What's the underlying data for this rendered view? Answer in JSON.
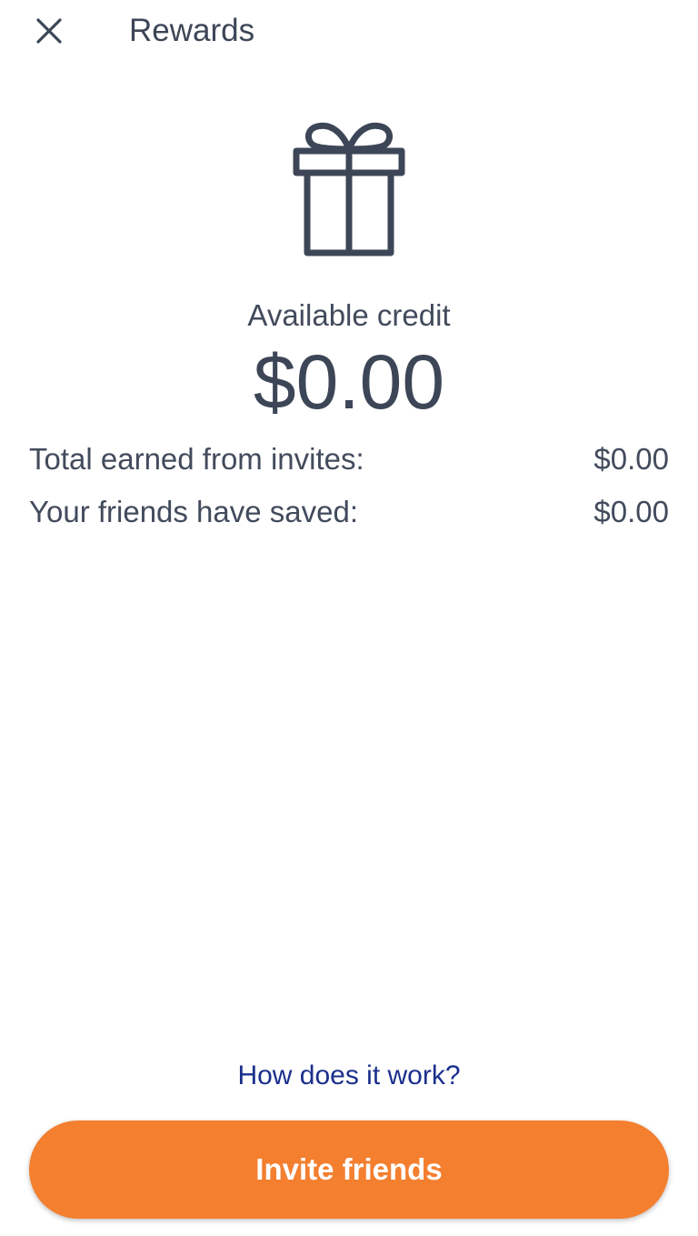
{
  "header": {
    "title": "Rewards",
    "close_icon": "close-icon"
  },
  "hero": {
    "icon": "gift-icon",
    "credit_label": "Available credit",
    "credit_value": "$0.00"
  },
  "stats": [
    {
      "label": "Total earned from invites:",
      "value": "$0.00"
    },
    {
      "label": "Your friends have saved:",
      "value": "$0.00"
    }
  ],
  "footer": {
    "help_link": "How does it work?",
    "cta_label": "Invite friends"
  },
  "colors": {
    "accent": "#f37f2f",
    "link": "#1b2f8c",
    "text": "#3d4657",
    "background": "#ffffff"
  }
}
